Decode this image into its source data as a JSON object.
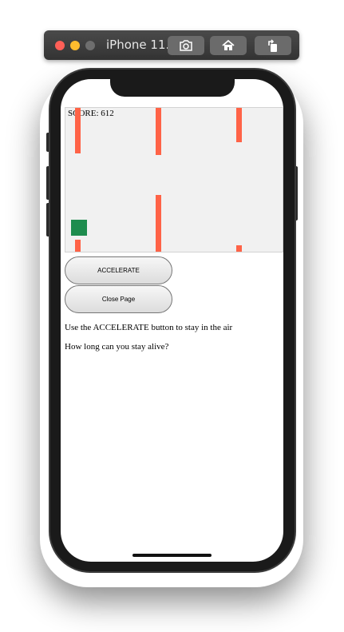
{
  "simulator": {
    "title": "iPhone 11...",
    "buttons": [
      {
        "name": "screenshot",
        "icon": "camera-icon"
      },
      {
        "name": "home",
        "icon": "home-icon"
      },
      {
        "name": "rotate",
        "icon": "rotate-icon"
      }
    ]
  },
  "game": {
    "score_text": "SCORE: 612",
    "obstacle_color": "#ff6347",
    "player_color": "#1e8c4e",
    "background_color": "#f1f1f1"
  },
  "controls": {
    "accelerate_label": "ACCELERATE",
    "close_label": "Close Page"
  },
  "instructions": {
    "line1": "Use the ACCELERATE button to stay in the air",
    "line2": "How long can you stay alive?"
  }
}
